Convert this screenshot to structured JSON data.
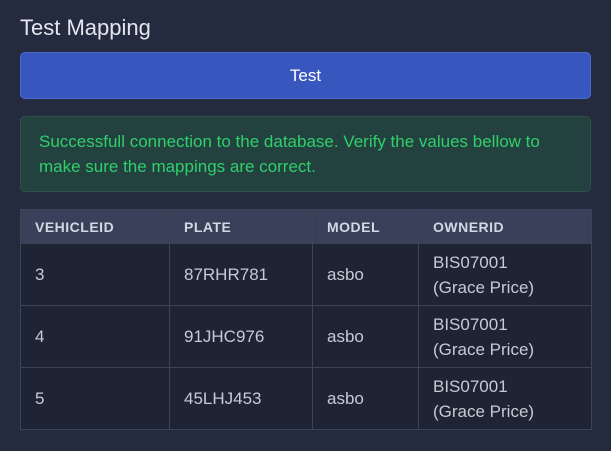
{
  "section": {
    "title": "Test Mapping",
    "test_button_label": "Test"
  },
  "alert": {
    "message": "Successfull connection to the database. Verify the values bellow to make sure the mappings are correct.",
    "color": "#2fcf6c"
  },
  "table": {
    "headers": [
      "VEHICLEID",
      "PLATE",
      "MODEL",
      "OWNERID"
    ],
    "rows": [
      {
        "vehicleid": "3",
        "plate": "87RHR781",
        "model": "asbo",
        "ownerid_line1": "BIS07001",
        "ownerid_line2": "(Grace Price)"
      },
      {
        "vehicleid": "4",
        "plate": "91JHC976",
        "model": "asbo",
        "ownerid_line1": "BIS07001",
        "ownerid_line2": "(Grace Price)"
      },
      {
        "vehicleid": "5",
        "plate": "45LHJ453",
        "model": "asbo",
        "ownerid_line1": "BIS07001",
        "ownerid_line2": "(Grace Price)"
      }
    ]
  },
  "colors": {
    "background": "#252b3e",
    "button": "#3757bf",
    "alert_bg": "#23423f",
    "table_header_bg": "#38405a",
    "table_row_bg": "#1f2434"
  }
}
